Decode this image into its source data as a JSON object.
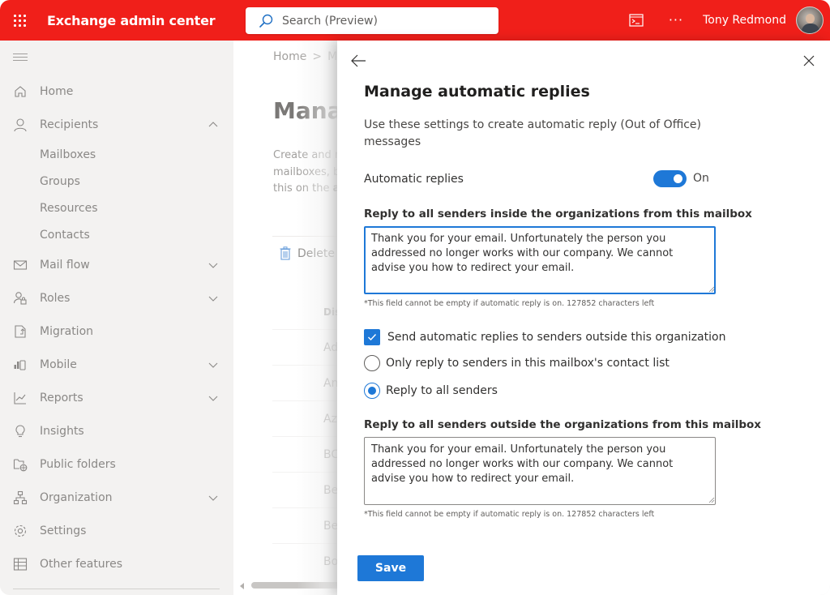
{
  "topbar": {
    "app_title": "Exchange admin center",
    "search_placeholder": "Search (Preview)",
    "user_name": "Tony Redmond",
    "more_label": "···",
    "brand_color": "#f01f1a"
  },
  "sidebar": {
    "items": [
      {
        "label": "Home",
        "icon": "home-icon"
      },
      {
        "label": "Recipients",
        "icon": "person-icon",
        "expanded": true,
        "children": [
          "Mailboxes",
          "Groups",
          "Resources",
          "Contacts"
        ]
      },
      {
        "label": "Mail flow",
        "icon": "mail-icon",
        "expandable": true
      },
      {
        "label": "Roles",
        "icon": "roles-icon",
        "expandable": true
      },
      {
        "label": "Migration",
        "icon": "migration-icon"
      },
      {
        "label": "Mobile",
        "icon": "mobile-icon",
        "expandable": true
      },
      {
        "label": "Reports",
        "icon": "reports-icon",
        "expandable": true
      },
      {
        "label": "Insights",
        "icon": "lightbulb-icon"
      },
      {
        "label": "Public folders",
        "icon": "public-folder-icon"
      },
      {
        "label": "Organization",
        "icon": "organization-icon",
        "expandable": true
      },
      {
        "label": "Settings",
        "icon": "gear-icon"
      },
      {
        "label": "Other features",
        "icon": "grid-table-icon"
      }
    ]
  },
  "main": {
    "breadcrumb": [
      "Home",
      "M"
    ],
    "title": "Manag",
    "description_lines": [
      "Create and m",
      "mailboxes, b",
      "this on the "
    ],
    "description_bold": "a",
    "delete_label": "Delete",
    "column_header": "Dis",
    "rows": [
      "Ad",
      "An",
      "Az",
      "BC",
      "Be",
      "Be",
      "Bo"
    ]
  },
  "panel": {
    "title": "Manage automatic replies",
    "description": "Use these settings to create automatic reply (Out of Office) messages",
    "toggle_label": "Automatic replies",
    "toggle_on": true,
    "toggle_state": "On",
    "inside_label": "Reply to all senders inside the organizations from this mailbox",
    "inside_message": "Thank you for your email. Unfortunately the person you addressed no longer works with our company. We cannot advise you how to redirect your email.",
    "inside_hint": "*This field cannot be empty if automatic reply is on. 127852 characters left",
    "outside_checkbox_label": "Send automatic replies to senders outside this organization",
    "outside_checkbox_checked": true,
    "radio_options": [
      {
        "label": "Only reply to senders in this mailbox's contact list",
        "checked": false
      },
      {
        "label": "Reply to all senders",
        "checked": true
      }
    ],
    "outside_label": "Reply to all senders outside the organizations from this mailbox",
    "outside_message": "Thank you for your email. Unfortunately the person you addressed no longer works with our company. We cannot advise you how to redirect your email.",
    "outside_hint": "*This field cannot be empty if automatic reply is on. 127852 characters left",
    "save_label": "Save",
    "accent_color": "#1e78d7"
  }
}
